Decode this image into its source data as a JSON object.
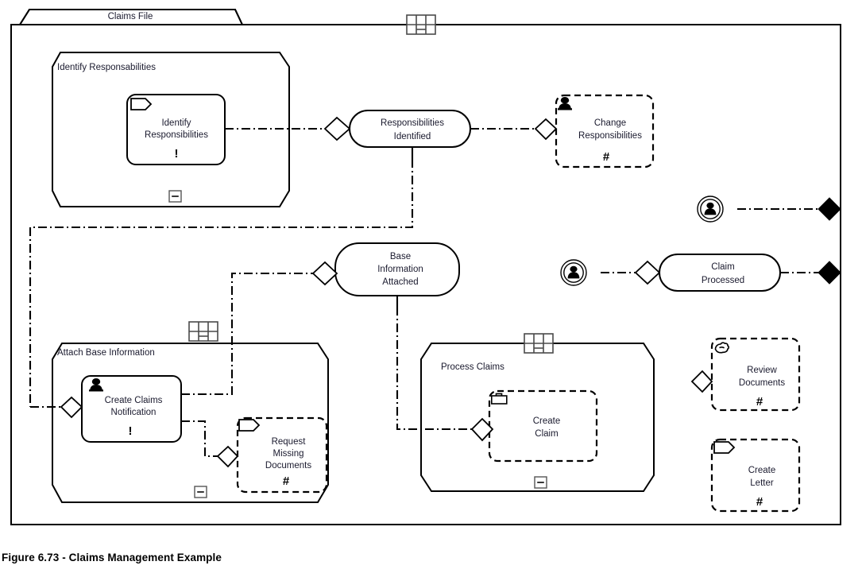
{
  "figure": {
    "caption": "Figure 6.73 - Claims Management Example",
    "frame_title": "Claims File"
  },
  "containers": [
    {
      "id": "identify-responsabilities",
      "label": "Identify Responsabilities",
      "collapse_mark": "minus",
      "header_icon": null
    },
    {
      "id": "attach-base-information",
      "label": "Attach Base Information",
      "collapse_mark": "minus",
      "header_icon": "grid-icon"
    },
    {
      "id": "process-claims",
      "label": "Process Claims",
      "collapse_mark": "minus",
      "header_icon": "grid-icon"
    }
  ],
  "activities": [
    {
      "id": "identify-responsibilities",
      "label_lines": [
        "Identify",
        "Responsibilities"
      ],
      "icon": "flag-icon",
      "mark": "!",
      "border": "solid"
    },
    {
      "id": "change-responsibilities",
      "label_lines": [
        "Change",
        "Responsibilities"
      ],
      "icon": "person-icon",
      "mark": "#",
      "border": "dashed"
    },
    {
      "id": "create-claims-notification",
      "label_lines": [
        "Create Claims",
        "Notification"
      ],
      "icon": "person-icon",
      "mark": "!",
      "border": "solid"
    },
    {
      "id": "request-missing-documents",
      "label_lines": [
        "Request",
        "Missing",
        "Documents"
      ],
      "icon": "flag-icon",
      "mark": "#",
      "border": "dashed"
    },
    {
      "id": "create-claim",
      "label_lines": [
        "Create",
        "Claim"
      ],
      "icon": "briefcase-icon",
      "mark": "",
      "border": "dashed"
    },
    {
      "id": "review-documents",
      "label_lines": [
        "Review",
        "Documents"
      ],
      "icon": "hand-icon",
      "mark": "#",
      "border": "dashed"
    },
    {
      "id": "create-letter",
      "label_lines": [
        "Create",
        "Letter"
      ],
      "icon": "flag-icon",
      "mark": "#",
      "border": "dashed"
    }
  ],
  "states": [
    {
      "id": "responsibilities-identified",
      "label_lines": [
        "Responsibilities",
        "Identified"
      ]
    },
    {
      "id": "base-information-attached",
      "label_lines": [
        "Base",
        "Information",
        "Attached"
      ]
    },
    {
      "id": "claim-processed",
      "label_lines": [
        "Claim",
        "Processed"
      ]
    }
  ],
  "ports": [
    {
      "id": "actor-port-top",
      "icon": "actor-circle-icon"
    },
    {
      "id": "actor-port-bottom",
      "icon": "actor-circle-icon"
    }
  ],
  "boundary_pins": [
    {
      "id": "boundary-pin-top",
      "shape": "filled-diamond"
    },
    {
      "id": "boundary-pin-bottom",
      "shape": "filled-diamond"
    }
  ],
  "colors": {
    "stroke": "#000000",
    "text": "#1a1a2e",
    "background": "#ffffff",
    "icon_gray": "#4a4a4a"
  }
}
